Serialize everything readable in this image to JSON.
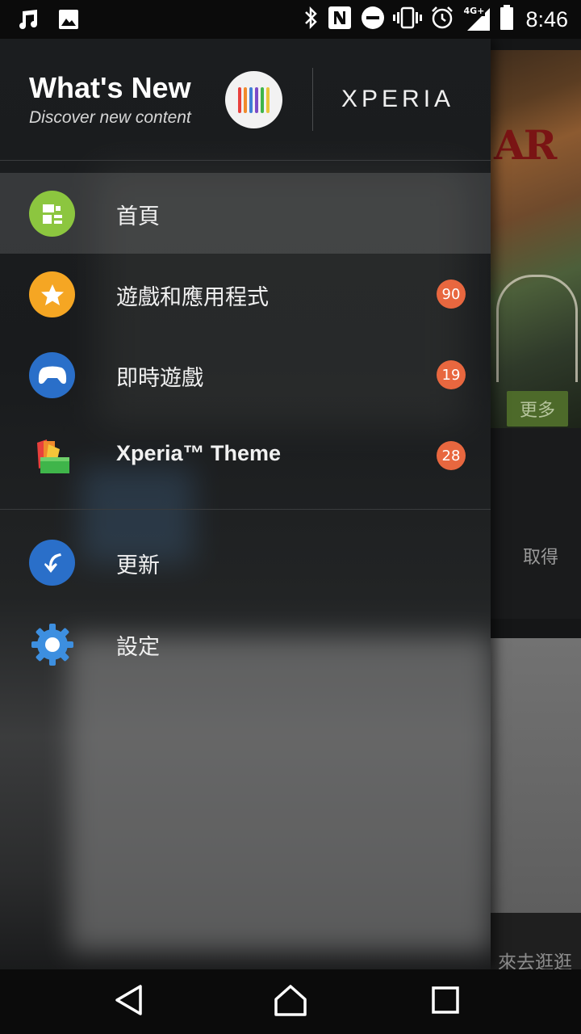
{
  "status_bar": {
    "time": "8:46",
    "network_label": "4G+",
    "icons": [
      "music-icon",
      "image-icon",
      "bluetooth-icon",
      "nfc-icon",
      "do-not-disturb-icon",
      "vibrate-icon",
      "alarm-icon",
      "signal-icon",
      "battery-icon"
    ]
  },
  "drawer": {
    "title": "What's New",
    "subtitle": "Discover new content",
    "brand": "XPERIA",
    "logo_bar_colors": [
      "#e8403c",
      "#f08a2c",
      "#3f7fd6",
      "#7b4bc7",
      "#3fb54a",
      "#e8c53a"
    ],
    "items": [
      {
        "label": "首頁",
        "icon": "home-grid-icon",
        "icon_color": "#8cc63f",
        "active": true
      },
      {
        "label": "遊戲和應用程式",
        "icon": "star-icon",
        "icon_color": "#f5a623",
        "badge": "90"
      },
      {
        "label": "即時遊戲",
        "icon": "gamepad-icon",
        "icon_color": "#2a6fc9",
        "badge": "19"
      },
      {
        "label": "Xperia™ Theme",
        "icon": "theme-palette-icon",
        "badge": "28"
      }
    ],
    "secondary_items": [
      {
        "label": "更新",
        "icon": "update-arrow-icon",
        "icon_color": "#2a6fc9"
      },
      {
        "label": "設定",
        "icon": "settings-gear-icon",
        "icon_color": "#3d8fe0"
      }
    ],
    "badge_color": "#e8673f"
  },
  "background_app": {
    "hero_text": "AR",
    "more_button": "更多",
    "get_label": "取得",
    "browse_label": "來去逛逛"
  },
  "nav_bar": {
    "back": "back-icon",
    "home": "home-icon",
    "recents": "recents-icon"
  }
}
